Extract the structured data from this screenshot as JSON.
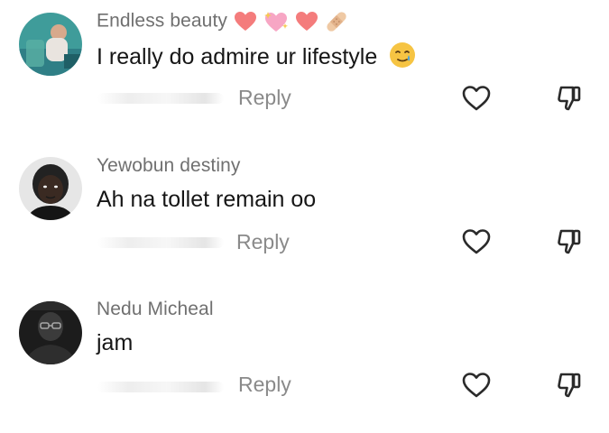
{
  "comments": [
    {
      "username": "Endless beauty",
      "username_emoji_icons": [
        "heart-icon",
        "heart-sparkle-icon",
        "heart-icon",
        "bandage-icon"
      ],
      "text": "I really do admire ur lifestyle",
      "text_emoji_icon": "smiling-face-with-tear-icon",
      "reply_label": "Reply",
      "like_icon": "heart-outline-icon",
      "dislike_icon": "thumbs-down-outline-icon"
    },
    {
      "username": "Yewobun destiny",
      "text": "Ah na tollet remain oo",
      "reply_label": "Reply",
      "like_icon": "heart-outline-icon",
      "dislike_icon": "thumbs-down-outline-icon"
    },
    {
      "username": "Nedu Micheal",
      "text": "jam",
      "reply_label": "Reply",
      "like_icon": "heart-outline-icon",
      "dislike_icon": "thumbs-down-outline-icon"
    }
  ],
  "colors": {
    "username": "#707070",
    "text": "#161616",
    "reply": "#8a8a8a",
    "icon": "#2a2a2a",
    "heart_emoji": "#f47c7c"
  }
}
